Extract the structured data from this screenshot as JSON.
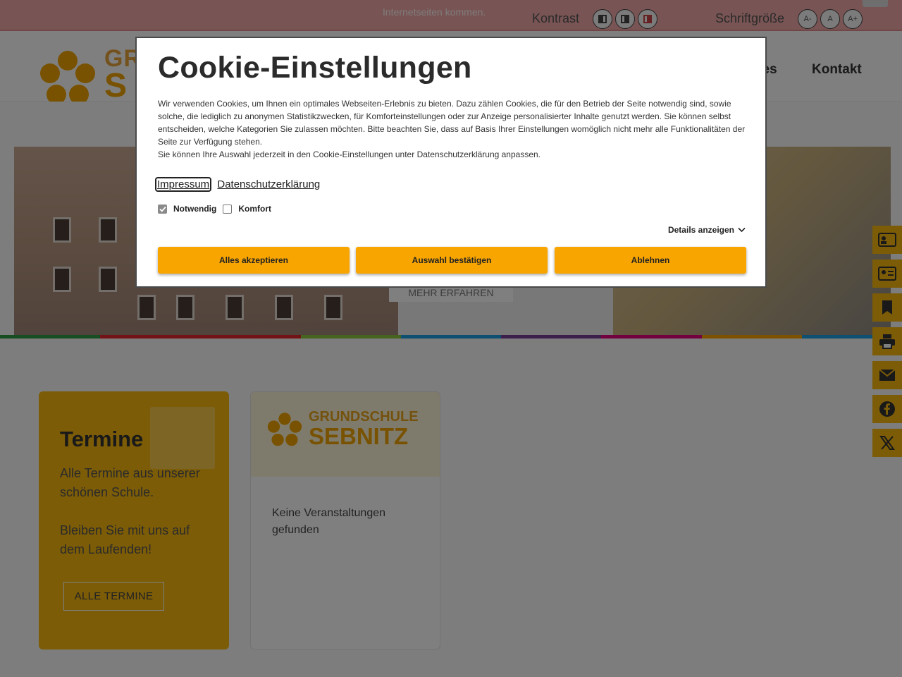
{
  "topbar": {
    "notice_text": "Internetseiten kommen.",
    "contrast_label": "Kontrast",
    "fontsize_label": "Schriftgröße",
    "font_buttons": [
      "A-",
      "A",
      "A+"
    ]
  },
  "header": {
    "logo_line1": "GRUNDSCHULE",
    "logo_line2": "S",
    "nav": [
      "lles",
      "Kontakt"
    ]
  },
  "hero": {
    "button_label": "MEHR ERFAHREN"
  },
  "termine_card": {
    "title": "Termine",
    "text1": "Alle Termine aus unserer schönen Schule.",
    "text2": "Bleiben Sie mit uns auf dem Laufenden!",
    "button_label": "ALLE TERMINE"
  },
  "events_card": {
    "banner_line1": "GRUNDSCHULE",
    "banner_line2": "SEBNITZ",
    "empty_text": "Keine Veranstaltungen gefunden"
  },
  "side_icons": [
    "contact-card-icon",
    "id-card-icon",
    "bookmark-icon",
    "printer-icon",
    "mail-icon",
    "facebook-icon",
    "x-icon"
  ],
  "cookie": {
    "title": "Cookie-Einstellungen",
    "description": "Wir verwenden Cookies, um Ihnen ein optimales Webseiten-Erlebnis zu bieten. Dazu zählen Cookies, die für den Betrieb der Seite notwendig sind, sowie solche, die lediglich zu anonymen Statistikzwecken, für Komforteinstellungen oder zur Anzeige personalisierter Inhalte genutzt werden. Sie können selbst entscheiden, welche Kategorien Sie zulassen möchten. Bitte beachten Sie, dass auf Basis Ihrer Einstellungen womöglich nicht mehr alle Funktionalitäten der Seite zur Verfügung stehen.",
    "description2": "Sie können Ihre Auswahl jederzeit in den Cookie-Einstellungen unter Datenschutzerklärung anpassen.",
    "link_impressum": "Impressum",
    "link_datenschutz": "Datenschutzerklärung",
    "check_notwendig": "Notwendig",
    "check_notwendig_checked": true,
    "check_komfort": "Komfort",
    "check_komfort_checked": false,
    "details_label": "Details anzeigen",
    "btn_accept_all": "Alles akzeptieren",
    "btn_confirm": "Auswahl bestätigen",
    "btn_reject": "Ablehnen"
  },
  "colors": {
    "accent": "#f8a500",
    "card_yellow": "#f8b90f",
    "topbar": "#f2a8a8",
    "strip": [
      "#2e9e44",
      "#e4262c",
      "#8dc63f",
      "#1ba1e2",
      "#7b3f98",
      "#e6007e",
      "#f8a500",
      "#1ba1e2"
    ]
  }
}
